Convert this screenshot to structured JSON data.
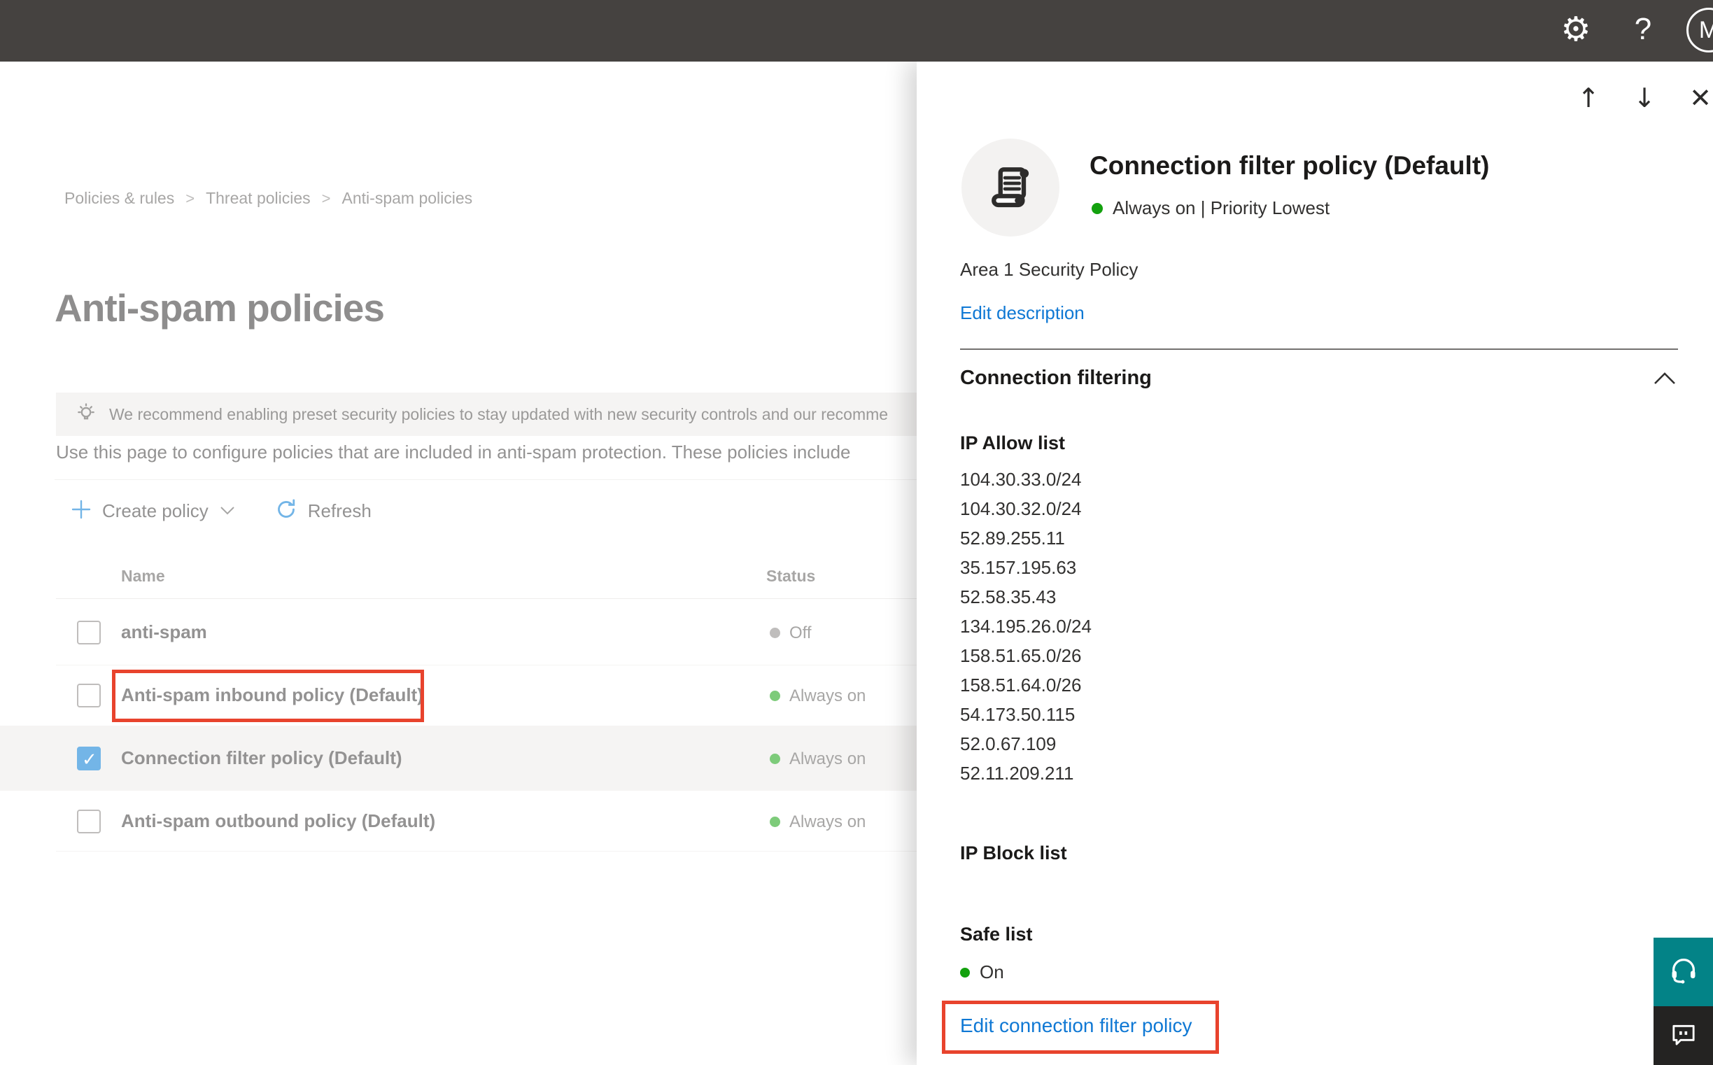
{
  "topbar": {
    "settings_glyph": "⚙",
    "help_glyph": "?",
    "avatar_initial": "M"
  },
  "breadcrumb": {
    "items": [
      "Policies & rules",
      "Threat policies",
      "Anti-spam policies"
    ]
  },
  "main": {
    "title": "Anti-spam policies",
    "banner_text": "We recommend enabling preset security policies to stay updated with new security controls and our recomme",
    "description": "Use this page to configure policies that are included in anti-spam protection. These policies include",
    "toolbar": {
      "create_label": "Create policy",
      "refresh_label": "Refresh"
    },
    "table": {
      "headers": {
        "name": "Name",
        "status": "Status"
      },
      "rows": [
        {
          "name": "anti-spam",
          "status": "Off",
          "dot_color": "#8a8886",
          "checked": false
        },
        {
          "name": "Anti-spam inbound policy (Default)",
          "status": "Always on",
          "dot_color": "#13a10e",
          "checked": false
        },
        {
          "name": "Connection filter policy (Default)",
          "status": "Always on",
          "dot_color": "#13a10e",
          "checked": true
        },
        {
          "name": "Anti-spam outbound policy (Default)",
          "status": "Always on",
          "dot_color": "#13a10e",
          "checked": false
        }
      ]
    }
  },
  "panel": {
    "nav": {
      "up_glyph": "↑",
      "down_glyph": "↓",
      "close_glyph": "✕"
    },
    "title": "Connection filter policy (Default)",
    "status_text": "Always on | Priority Lowest",
    "status_color": "#13a10e",
    "description": "Area 1 Security Policy",
    "edit_description_label": "Edit description",
    "section_title": "Connection filtering",
    "ip_allow": {
      "heading": "IP Allow list",
      "items": [
        "104.30.33.0/24",
        "104.30.32.0/24",
        "52.89.255.11",
        "35.157.195.63",
        "52.58.35.43",
        "134.195.26.0/24",
        "158.51.65.0/26",
        "158.51.64.0/26",
        "54.173.50.115",
        "52.0.67.109",
        "52.11.209.211"
      ]
    },
    "ip_block": {
      "heading": "IP Block list"
    },
    "safe_list": {
      "heading": "Safe list",
      "value": "On",
      "value_color": "#13a10e"
    },
    "edit_policy_label": "Edit connection filter policy"
  },
  "colors": {
    "accent_blue": "#0078d4",
    "annotation_red": "#e8432d",
    "status_green": "#13a10e",
    "teal_button": "#038387",
    "topbar_gray": "#454240"
  }
}
